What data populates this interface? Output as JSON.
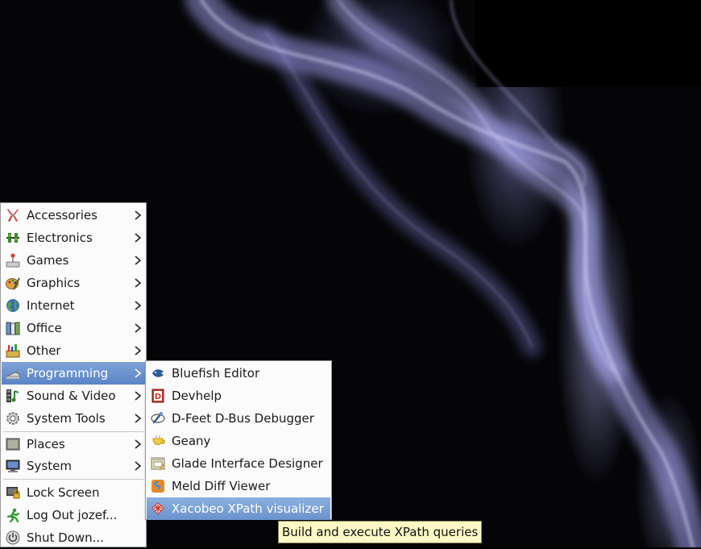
{
  "main_menu": {
    "items": [
      {
        "label": "Accessories",
        "icon": "accessories-icon"
      },
      {
        "label": "Electronics",
        "icon": "electronics-icon"
      },
      {
        "label": "Games",
        "icon": "games-icon"
      },
      {
        "label": "Graphics",
        "icon": "graphics-icon"
      },
      {
        "label": "Internet",
        "icon": "internet-icon"
      },
      {
        "label": "Office",
        "icon": "office-icon"
      },
      {
        "label": "Other",
        "icon": "other-icon"
      },
      {
        "label": "Programming",
        "icon": "programming-icon",
        "active": true
      },
      {
        "label": "Sound & Video",
        "icon": "sound-video-icon"
      },
      {
        "label": "System Tools",
        "icon": "system-tools-icon"
      }
    ],
    "group2": [
      {
        "label": "Places",
        "icon": "places-icon"
      },
      {
        "label": "System",
        "icon": "system-icon"
      }
    ],
    "group3": [
      {
        "label": "Lock Screen",
        "icon": "lock-screen-icon"
      },
      {
        "label": "Log Out jozef...",
        "icon": "log-out-icon"
      },
      {
        "label": "Shut Down...",
        "icon": "shut-down-icon"
      }
    ]
  },
  "programming_menu": {
    "items": [
      {
        "label": "Bluefish Editor",
        "icon": "bluefish-icon"
      },
      {
        "label": "Devhelp",
        "icon": "devhelp-icon"
      },
      {
        "label": "D-Feet D-Bus Debugger",
        "icon": "d-feet-icon"
      },
      {
        "label": "Geany",
        "icon": "geany-icon"
      },
      {
        "label": "Glade Interface Designer",
        "icon": "glade-icon"
      },
      {
        "label": "Meld Diff Viewer",
        "icon": "meld-icon"
      },
      {
        "label": "Xacobeo XPath visualizer",
        "icon": "xacobeo-icon",
        "hovered": true
      }
    ]
  },
  "tooltip": {
    "text": "Build and execute XPath queries"
  },
  "colors": {
    "highlight": "#6a8fcf",
    "tooltip_bg": "#fbf8c6",
    "menu_bg": "#fbfbfb"
  }
}
